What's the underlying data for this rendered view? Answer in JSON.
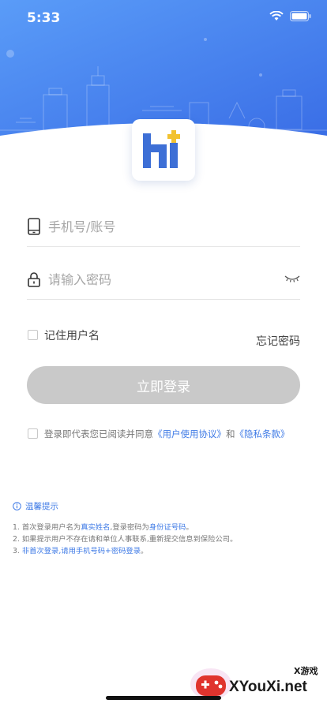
{
  "status_bar": {
    "time": "5:33"
  },
  "login": {
    "phone_placeholder": "手机号/账号",
    "password_placeholder": "请输入密码",
    "remember_label": "记住用户名",
    "forgot_label": "忘记密码",
    "submit_label": "立即登录"
  },
  "agreement": {
    "prefix": "登录即代表您已阅读并同意",
    "user_agreement": "《用户使用协议》",
    "and": "和",
    "privacy": "《隐私条款》"
  },
  "tips": {
    "title": "温馨提示",
    "line1": {
      "a": "1. 首次登录用户名为",
      "b": "真实姓名",
      "c": ",登录密码为",
      "d": "身份证号码",
      "e": "。"
    },
    "line2": "2. 如果提示用户不存在请和单位人事联系,重新提交信息到保险公司。",
    "line3": {
      "a": "3. ",
      "b": "非首次登录,请用手机号码+密码登录",
      "c": "。"
    }
  },
  "watermark": {
    "text": "XYouXi.net",
    "small": "X游戏"
  },
  "colors": {
    "accent": "#3e7ae6",
    "header_top": "#4b8ef7",
    "button_disabled": "#c9c9c9",
    "logo_blue": "#3d6fd6",
    "logo_gold": "#f2c230"
  }
}
